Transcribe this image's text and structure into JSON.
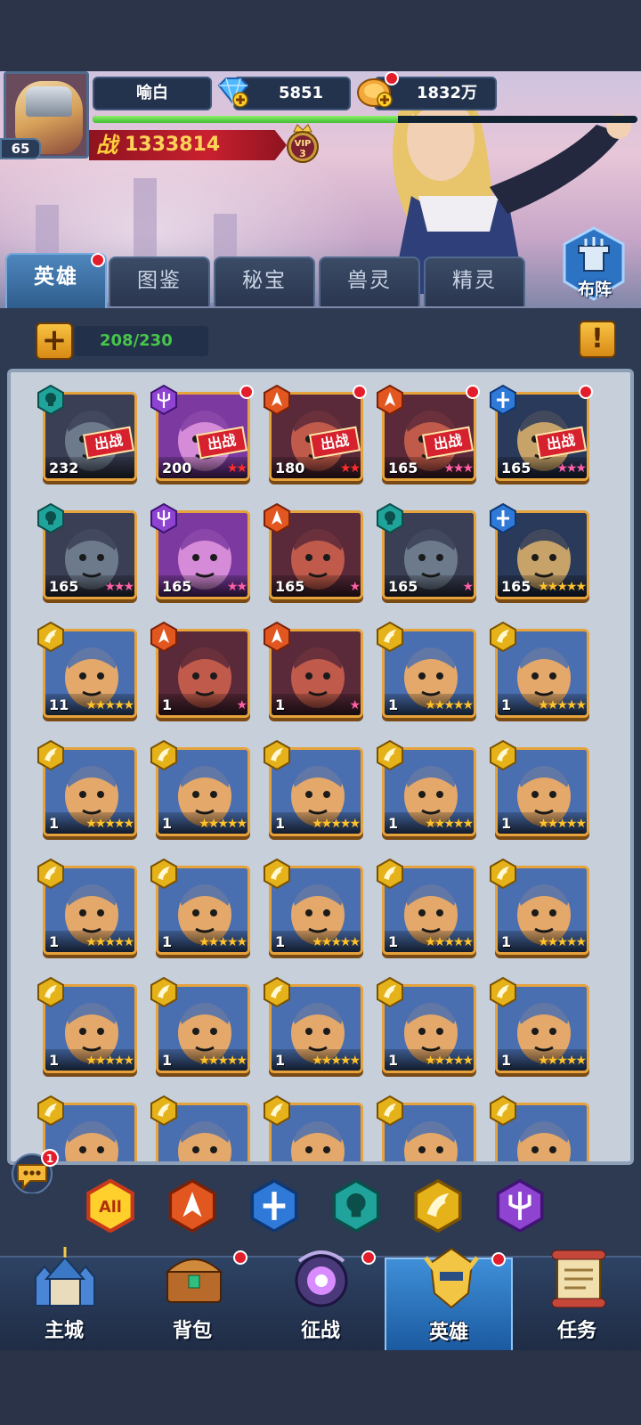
{
  "player": {
    "name": "喻白",
    "level": "65",
    "gems": "5851",
    "gold": "1832万",
    "power_label": "战",
    "power": "1333814",
    "vip_label": "VIP",
    "vip_level": "3",
    "exp_progress": 0.56
  },
  "tabs": [
    {
      "label": "英雄",
      "active": true,
      "dot": true
    },
    {
      "label": "图鉴"
    },
    {
      "label": "秘宝"
    },
    {
      "label": "兽灵"
    },
    {
      "label": "精灵"
    }
  ],
  "deploy_button": "布阵",
  "hero_count": "208/230",
  "deploy_tag": "出战",
  "heroes": [
    {
      "level": "232",
      "faction": "skull",
      "stars": 0,
      "star_color": "red",
      "deployed": true,
      "dot": false
    },
    {
      "level": "200",
      "faction": "trident",
      "stars": 2,
      "star_color": "red",
      "deployed": true,
      "dot": true
    },
    {
      "level": "180",
      "faction": "demon",
      "stars": 2,
      "star_color": "red",
      "deployed": true,
      "dot": true
    },
    {
      "level": "165",
      "faction": "demon",
      "stars": 3,
      "star_color": "pink",
      "deployed": true,
      "dot": true
    },
    {
      "level": "165",
      "faction": "cross",
      "stars": 3,
      "star_color": "pink",
      "deployed": true,
      "dot": true
    },
    {
      "level": "165",
      "faction": "skull",
      "stars": 3,
      "star_color": "pink"
    },
    {
      "level": "165",
      "faction": "trident",
      "stars": 2,
      "star_color": "pink"
    },
    {
      "level": "165",
      "faction": "demon",
      "stars": 1,
      "star_color": "pink"
    },
    {
      "level": "165",
      "faction": "skull",
      "stars": 1,
      "star_color": "pink"
    },
    {
      "level": "165",
      "faction": "cross",
      "stars": 5,
      "star_color": "gold"
    },
    {
      "level": "11",
      "faction": "wing",
      "stars": 5,
      "star_color": "gold"
    },
    {
      "level": "1",
      "faction": "demon",
      "stars": 1,
      "star_color": "pink"
    },
    {
      "level": "1",
      "faction": "demon",
      "stars": 1,
      "star_color": "pink"
    },
    {
      "level": "1",
      "faction": "wing",
      "stars": 5,
      "star_color": "gold"
    },
    {
      "level": "1",
      "faction": "wing",
      "stars": 5,
      "star_color": "gold"
    },
    {
      "level": "1",
      "faction": "wing",
      "stars": 5,
      "star_color": "gold"
    },
    {
      "level": "1",
      "faction": "wing",
      "stars": 5,
      "star_color": "gold"
    },
    {
      "level": "1",
      "faction": "wing",
      "stars": 5,
      "star_color": "gold"
    },
    {
      "level": "1",
      "faction": "wing",
      "stars": 5,
      "star_color": "gold"
    },
    {
      "level": "1",
      "faction": "wing",
      "stars": 5,
      "star_color": "gold"
    },
    {
      "level": "1",
      "faction": "wing",
      "stars": 5,
      "star_color": "gold"
    },
    {
      "level": "1",
      "faction": "wing",
      "stars": 5,
      "star_color": "gold"
    },
    {
      "level": "1",
      "faction": "wing",
      "stars": 5,
      "star_color": "gold"
    },
    {
      "level": "1",
      "faction": "wing",
      "stars": 5,
      "star_color": "gold"
    },
    {
      "level": "1",
      "faction": "wing",
      "stars": 5,
      "star_color": "gold"
    },
    {
      "level": "1",
      "faction": "wing",
      "stars": 5,
      "star_color": "gold"
    },
    {
      "level": "1",
      "faction": "wing",
      "stars": 5,
      "star_color": "gold"
    },
    {
      "level": "1",
      "faction": "wing",
      "stars": 5,
      "star_color": "gold"
    },
    {
      "level": "1",
      "faction": "wing",
      "stars": 5,
      "star_color": "gold"
    },
    {
      "level": "1",
      "faction": "wing",
      "stars": 5,
      "star_color": "gold"
    },
    {
      "level": "",
      "faction": "wing",
      "stars": 0,
      "star_color": "gold"
    },
    {
      "level": "",
      "faction": "wing",
      "stars": 0,
      "star_color": "gold"
    },
    {
      "level": "",
      "faction": "wing",
      "stars": 0,
      "star_color": "gold"
    },
    {
      "level": "",
      "faction": "wing",
      "stars": 0,
      "star_color": "gold"
    },
    {
      "level": "",
      "faction": "wing",
      "stars": 0,
      "star_color": "gold"
    }
  ],
  "filters": [
    {
      "name": "all",
      "label": "All"
    },
    {
      "name": "demon"
    },
    {
      "name": "cross"
    },
    {
      "name": "skull"
    },
    {
      "name": "wing"
    },
    {
      "name": "trident"
    }
  ],
  "chat_badge": "1",
  "nav": [
    {
      "label": "主城",
      "icon": "castle"
    },
    {
      "label": "背包",
      "icon": "chest",
      "dot": true
    },
    {
      "label": "征战",
      "icon": "dragon-portal",
      "dot": true
    },
    {
      "label": "英雄",
      "icon": "helmet",
      "active": true,
      "dot": true
    },
    {
      "label": "任务",
      "icon": "scroll"
    }
  ],
  "colors": {
    "card_border": "#e6a33c",
    "tab_active": "#3f79b4",
    "count_text": "#46c64a",
    "star_gold": "#ffc22a",
    "star_pink": "#ff5fa6",
    "star_red": "#ff2c2c"
  }
}
